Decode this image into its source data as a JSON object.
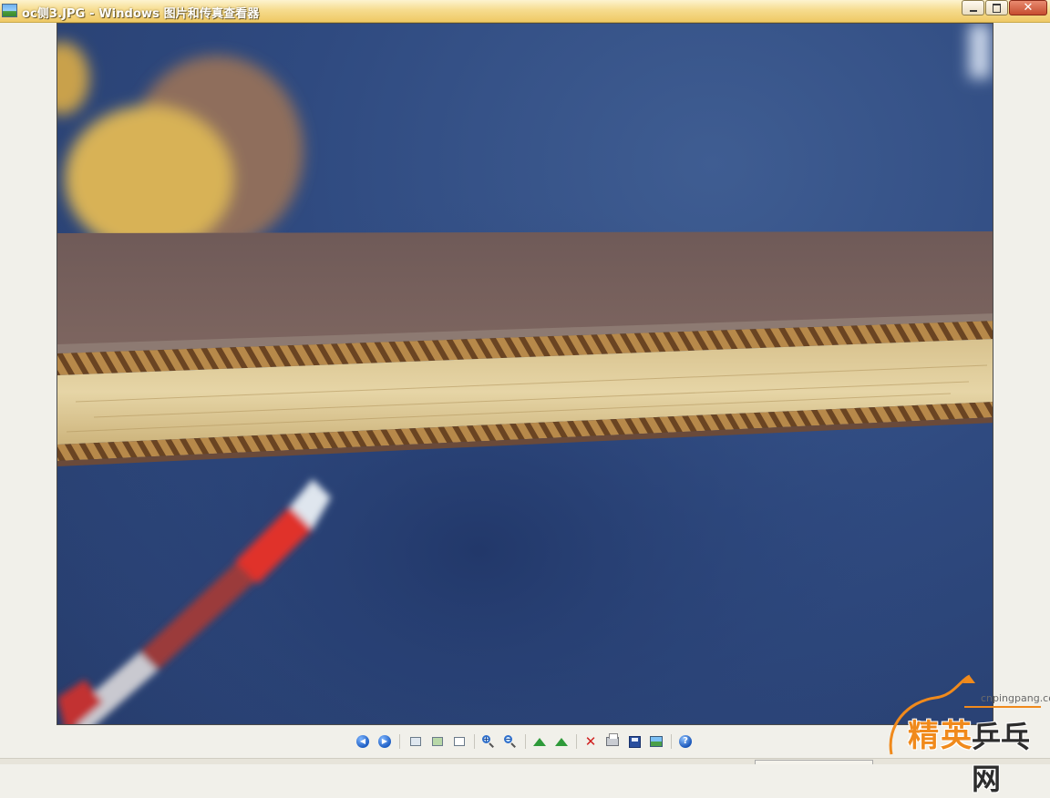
{
  "window": {
    "title": "oc侧3.JPG - Windows 图片和传真查看器",
    "close_glyph": "✕"
  },
  "toolbar": {
    "previous_glyph": "◀",
    "next_glyph": "▶",
    "zoom_in_glyph": "+",
    "zoom_out_glyph": "−",
    "delete_glyph": "✕",
    "help_glyph": "?"
  },
  "icons": [
    "previous-image-icon",
    "next-image-icon",
    "best-fit-icon",
    "actual-size-icon",
    "slideshow-icon",
    "zoom-in-icon",
    "zoom-out-icon",
    "rotate-clockwise-icon",
    "rotate-counterclockwise-icon",
    "delete-icon",
    "print-icon",
    "copy-to-icon",
    "open-for-editing-icon",
    "help-icon"
  ],
  "watermark": {
    "url": "cnpingpang.com",
    "char_jing": "精",
    "char_ying": "英",
    "char_pingpang": "乒乓网"
  },
  "colors": {
    "titlebar": "#f6dc8f",
    "photo_background": "#2f4a80",
    "watermark_orange": "#f08a1c"
  }
}
